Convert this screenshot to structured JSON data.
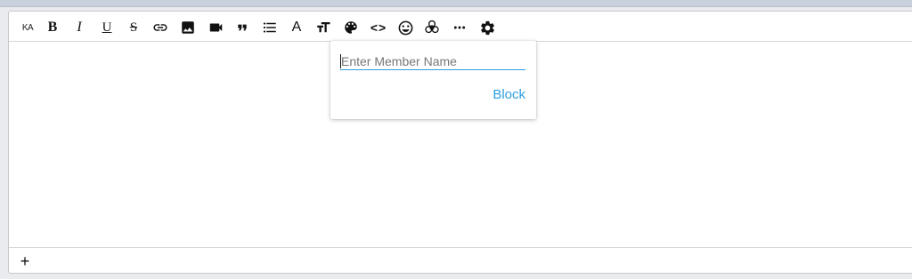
{
  "toolbar": {
    "items": [
      {
        "name": "ka-language-button",
        "label": "KA"
      },
      {
        "name": "bold-button",
        "label": "B"
      },
      {
        "name": "italic-button",
        "label": "I"
      },
      {
        "name": "underline-button",
        "label": "U"
      },
      {
        "name": "strikethrough-button",
        "label": "S"
      },
      {
        "name": "link-button",
        "icon": "link-icon"
      },
      {
        "name": "image-button",
        "icon": "image-icon"
      },
      {
        "name": "video-button",
        "icon": "video-camera-icon"
      },
      {
        "name": "quote-button",
        "icon": "quote-icon"
      },
      {
        "name": "list-button",
        "icon": "bullet-list-icon"
      },
      {
        "name": "font-button",
        "label": "A"
      },
      {
        "name": "text-size-button",
        "icon": "text-size-icon"
      },
      {
        "name": "color-palette-button",
        "icon": "palette-icon"
      },
      {
        "name": "code-button",
        "label": "<>"
      },
      {
        "name": "emoji-button",
        "icon": "smiley-icon"
      },
      {
        "name": "biohazard-button",
        "icon": "biohazard-icon"
      },
      {
        "name": "more-button",
        "icon": "more-dots-icon"
      },
      {
        "name": "settings-button",
        "icon": "gear-icon"
      }
    ]
  },
  "popover": {
    "input_placeholder": "Enter Member Name",
    "input_value": "",
    "block_label": "Block"
  },
  "footer": {
    "add_label": "+"
  },
  "colors": {
    "accent": "#2d9ee0",
    "border": "#c8c8c8",
    "page_bg": "#e9ebee"
  }
}
